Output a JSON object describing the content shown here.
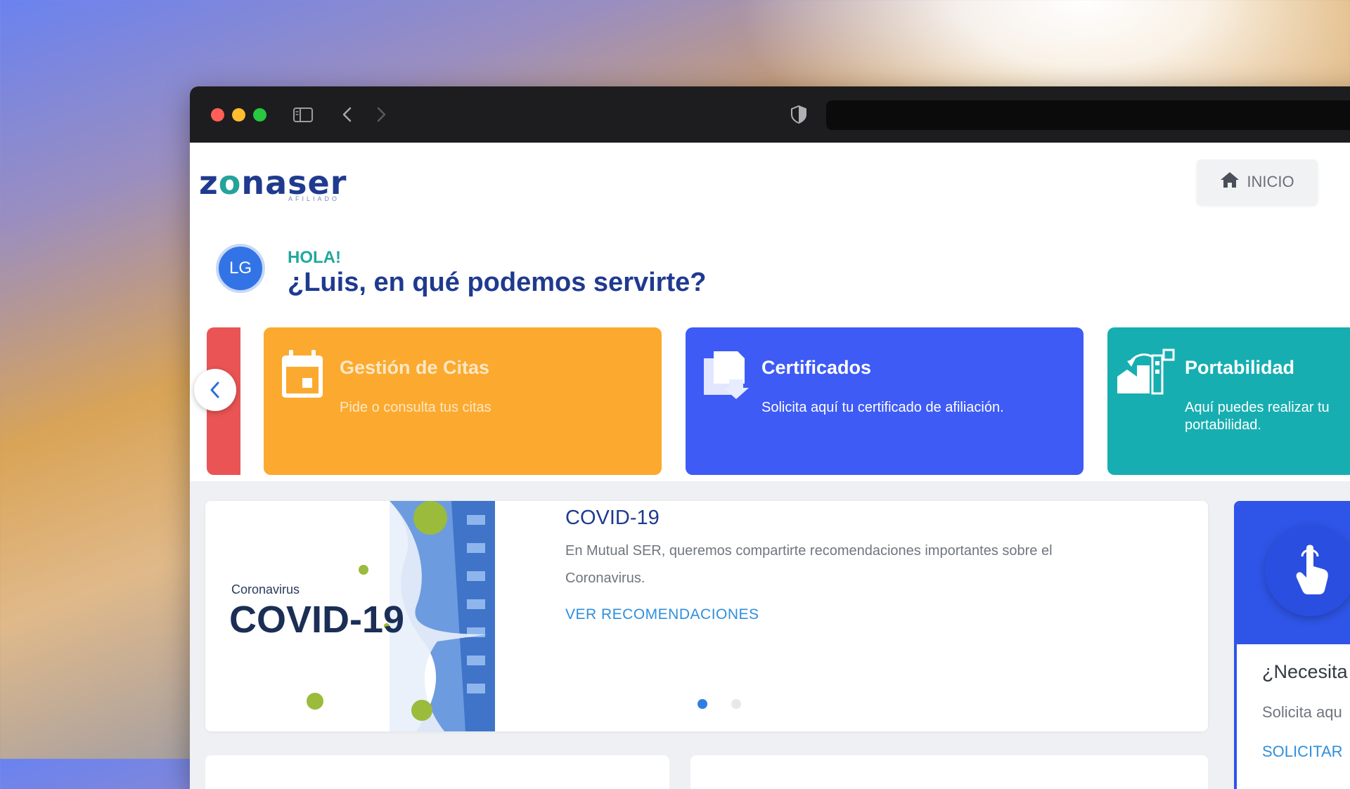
{
  "header": {
    "logo_part1": "z",
    "logo_part2": "o",
    "logo_part3": "naser",
    "logo_sub": "AFILIADO",
    "home_label": "INICIO"
  },
  "greeting": {
    "avatar_initials": "LG",
    "hola": "HOLA!",
    "question": "¿Luis, en qué podemos servirte?"
  },
  "cards": [
    {
      "title": "Gestión de Citas",
      "desc": "Pide o consulta tus citas",
      "color": "#fbaa2f",
      "icon": "calendar-icon"
    },
    {
      "title": "Certificados",
      "desc": "Solicita aquí tu certificado de afiliación.",
      "color": "#3e5bf6",
      "icon": "documents-icon"
    },
    {
      "title": "Portabilidad",
      "desc": "Aquí puedes realizar tu portabilidad.",
      "color": "#17aeb1",
      "icon": "buildings-icon"
    }
  ],
  "covid": {
    "image_small": "Coronavirus",
    "image_big": "COVID-19",
    "title": "COVID-19",
    "description": "En Mutual SER, queremos compartirte recomendaciones importantes sobre el Coronavirus.",
    "link": "VER RECOMENDACIONES"
  },
  "side": {
    "question": "¿Necesita",
    "desc": "Solicita aqu",
    "link": "SOLICITAR"
  }
}
